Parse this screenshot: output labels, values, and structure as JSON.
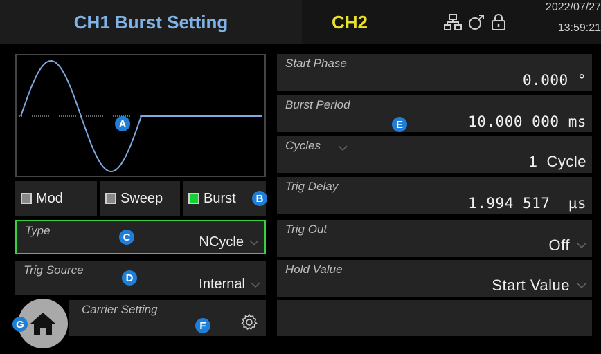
{
  "header": {
    "title": "CH1 Burst Setting",
    "channel_tab": "CH2",
    "date": "2022/07/27",
    "time": "13:59:21",
    "icons": [
      "network-icon",
      "usb-icon",
      "lock-icon"
    ]
  },
  "modes": [
    {
      "label": "Mod",
      "checked": false
    },
    {
      "label": "Sweep",
      "checked": false
    },
    {
      "label": "Burst",
      "checked": true
    }
  ],
  "left_params": {
    "type": {
      "label": "Type",
      "value": "NCycle"
    },
    "trig_source": {
      "label": "Trig Source",
      "value": "Internal"
    },
    "carrier": {
      "label": "Carrier Setting"
    }
  },
  "right_params": {
    "start_phase": {
      "label": "Start Phase",
      "value": "0.000 °"
    },
    "burst_period": {
      "label": "Burst Period",
      "value": "10.000 000 ms"
    },
    "cycles": {
      "label": "Cycles",
      "value": "1  Cycle"
    },
    "trig_delay": {
      "label": "Trig Delay",
      "value": "1.994 517  µs"
    },
    "trig_out": {
      "label": "Trig Out",
      "value": "Off"
    },
    "hold_value": {
      "label": "Hold Value",
      "value": "Start Value"
    }
  },
  "badges": {
    "a": "A",
    "b": "B",
    "c": "C",
    "d": "D",
    "e": "E",
    "f": "F",
    "g": "G"
  },
  "colors": {
    "accent_blue": "#7fb2e6",
    "channel_yellow": "#e9e22a",
    "selected_green": "#39d03e",
    "badge_blue": "#1f7fd8"
  }
}
